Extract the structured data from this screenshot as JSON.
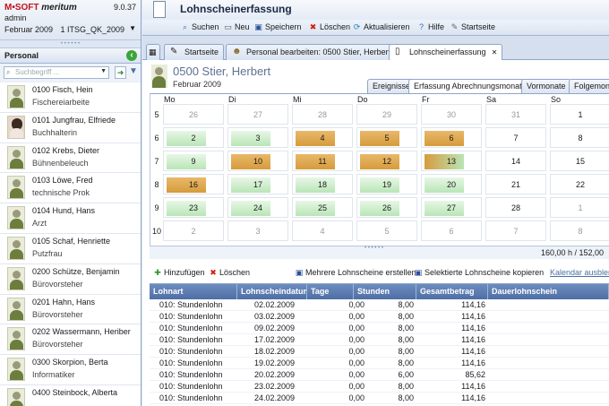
{
  "app": {
    "brand_first": "M•SOFT",
    "brand_second": "meritum",
    "version": "9.0.37",
    "user": "admin",
    "period": "Februar 2009",
    "client": "1 ITSG_QK_2009"
  },
  "sidebar": {
    "panel_title": "Personal",
    "search_placeholder": "Suchbegriff ...",
    "employees": [
      {
        "name": "0100 Fisch, Hein",
        "role": "Fischereiarbeite",
        "photo": false
      },
      {
        "name": "0101 Jungfrau, Elfriede",
        "role": "Buchhalterin",
        "photo": true
      },
      {
        "name": "0102 Krebs, Dieter",
        "role": "Bühnenbeleuch",
        "photo": false
      },
      {
        "name": "0103 Löwe, Fred",
        "role": "technische Prok",
        "photo": false
      },
      {
        "name": "0104 Hund, Hans",
        "role": "Arzt",
        "photo": false
      },
      {
        "name": "0105 Schaf, Henriette",
        "role": "Putzfrau",
        "photo": false
      },
      {
        "name": "0200 Schütze, Benjamin",
        "role": "Bürovorsteher",
        "photo": false
      },
      {
        "name": "0201 Hahn, Hans",
        "role": "Bürovorsteher",
        "photo": false
      },
      {
        "name": "0202 Wassermann, Heriber",
        "role": "Bürovorsteher",
        "photo": false
      },
      {
        "name": "0300 Skorpion, Berta",
        "role": "Informatiker",
        "photo": false
      },
      {
        "name": "0400 Steinbock, Alberta",
        "role": "",
        "photo": false
      }
    ]
  },
  "main": {
    "title": "Lohnscheinerfassung",
    "toolbar": {
      "suchen": "Suchen",
      "neu": "Neu",
      "speichern": "Speichern",
      "loeschen": "Löschen",
      "aktualisieren": "Aktualisieren",
      "hilfe": "Hilfe",
      "startseite": "Startseite"
    },
    "tabs": [
      {
        "label": "Startseite"
      },
      {
        "label": "Personal bearbeiten: 0500 Stier, Herbert"
      },
      {
        "label": "Lohnscheinerfassung"
      }
    ],
    "employee": {
      "title": "0500 Stier, Herbert",
      "period": "Februar 2009"
    },
    "subtabs": [
      {
        "label": "Ereignisse"
      },
      {
        "label": "Erfassung Abrechnungsmonat"
      },
      {
        "label": "Vormonate"
      },
      {
        "label": "Folgemon"
      }
    ],
    "calendar": {
      "days": [
        "Mo",
        "Di",
        "Mi",
        "Do",
        "Fr",
        "Sa",
        "So"
      ],
      "weeks": [
        {
          "no": "5",
          "cells": [
            [
              "26",
              "x"
            ],
            [
              "27",
              "x"
            ],
            [
              "28",
              "x"
            ],
            [
              "29",
              "x"
            ],
            [
              "30",
              "x"
            ],
            [
              "31",
              "x"
            ],
            [
              "1",
              ""
            ]
          ]
        },
        {
          "no": "6",
          "cells": [
            [
              "2",
              "g"
            ],
            [
              "3",
              "g"
            ],
            [
              "4",
              "o"
            ],
            [
              "5",
              "o"
            ],
            [
              "6",
              "o"
            ],
            [
              "7",
              ""
            ],
            [
              "8",
              ""
            ]
          ]
        },
        {
          "no": "7",
          "cells": [
            [
              "9",
              "g"
            ],
            [
              "10",
              "o"
            ],
            [
              "11",
              "o"
            ],
            [
              "12",
              "o"
            ],
            [
              "13",
              "o"
            ],
            [
              "14",
              ""
            ],
            [
              "15",
              ""
            ]
          ]
        },
        {
          "no": "8",
          "cells": [
            [
              "16",
              "o"
            ],
            [
              "17",
              "g"
            ],
            [
              "18",
              "g"
            ],
            [
              "19",
              "g"
            ],
            [
              "20",
              "g"
            ],
            [
              "21",
              ""
            ],
            [
              "22",
              ""
            ]
          ]
        },
        {
          "no": "9",
          "cells": [
            [
              "23",
              "g"
            ],
            [
              "24",
              "g"
            ],
            [
              "25",
              "g"
            ],
            [
              "26",
              "g"
            ],
            [
              "27",
              "g"
            ],
            [
              "28",
              ""
            ],
            [
              "1",
              "x"
            ]
          ]
        },
        {
          "no": "10",
          "cells": [
            [
              "2",
              "x"
            ],
            [
              "3",
              "x"
            ],
            [
              "4",
              "x"
            ],
            [
              "5",
              "x"
            ],
            [
              "6",
              "x"
            ],
            [
              "7",
              "x"
            ],
            [
              "8",
              "x"
            ]
          ]
        }
      ],
      "total": "160,00 h / 152,00"
    },
    "table_toolbar": {
      "add": "Hinzufügen",
      "delete": "Löschen",
      "multi": "Mehrere Lohnscheine erstellen",
      "copy": "Selektierte Lohnscheine kopieren",
      "hide": "Kalendar ausblend"
    },
    "grid": {
      "headers": [
        "Lohnart",
        "Lohnscheindatum",
        "Tage",
        "Stunden",
        "Gesamtbetrag",
        "Dauerlohnschein"
      ],
      "rows": [
        [
          "010: Stundenlohn",
          "02.02.2009",
          "0,00",
          "8,00",
          "114,16"
        ],
        [
          "010: Stundenlohn",
          "03.02.2009",
          "0,00",
          "8,00",
          "114,16"
        ],
        [
          "010: Stundenlohn",
          "09.02.2009",
          "0,00",
          "8,00",
          "114,16"
        ],
        [
          "010: Stundenlohn",
          "17.02.2009",
          "0,00",
          "8,00",
          "114,16"
        ],
        [
          "010: Stundenlohn",
          "18.02.2009",
          "0,00",
          "8,00",
          "114,16"
        ],
        [
          "010: Stundenlohn",
          "19.02.2009",
          "0,00",
          "8,00",
          "114,16"
        ],
        [
          "010: Stundenlohn",
          "20.02.2009",
          "0,00",
          "6,00",
          "85,62"
        ],
        [
          "010: Stundenlohn",
          "23.02.2009",
          "0,00",
          "8,00",
          "114,16"
        ],
        [
          "010: Stundenlohn",
          "24.02.2009",
          "0,00",
          "8,00",
          "114,16"
        ]
      ]
    }
  }
}
